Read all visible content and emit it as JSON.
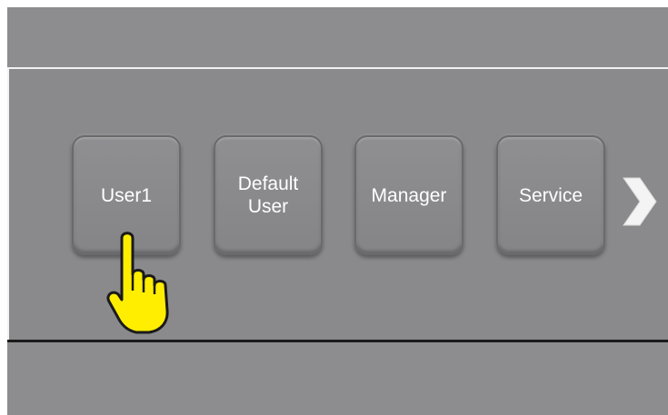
{
  "users": [
    {
      "label": "User1"
    },
    {
      "label": "Default\nUser"
    },
    {
      "label": "Manager"
    },
    {
      "label": "Service"
    }
  ],
  "icons": {
    "next": "chevron-right-icon",
    "pointer": "pointing-hand-icon"
  },
  "colors": {
    "background": "#8c8c8f",
    "button": "#8a8a8d",
    "text": "#ffffff",
    "hand": "#ffee00"
  }
}
